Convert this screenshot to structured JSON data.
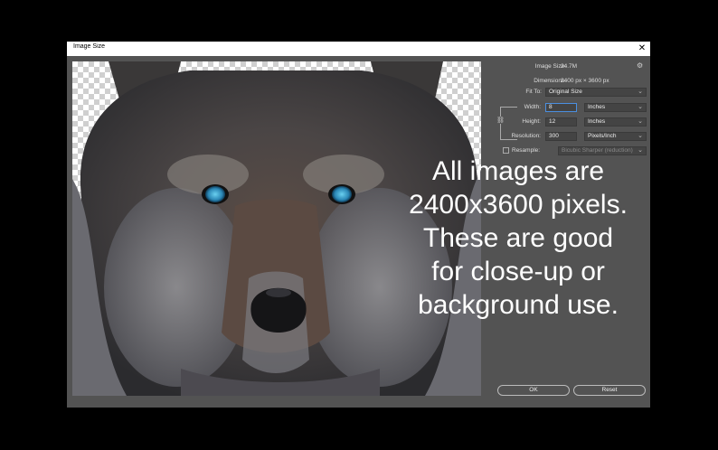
{
  "dialog": {
    "title": "Image Size",
    "close": "✕"
  },
  "overlay_text": "All images are\n2400x3600 pixels.\nThese are good\nfor close-up or\nbackground use.",
  "panel": {
    "image_size_label": "Image Size:",
    "image_size_value": "24.7M",
    "dimensions_label": "Dimensions:",
    "dimensions_value": "2400 px  ×  3600 px",
    "fit_to_label": "Fit To:",
    "fit_to_value": "Original Size",
    "width_label": "Width:",
    "width_value": "8",
    "width_unit": "Inches",
    "height_label": "Height:",
    "height_value": "12",
    "height_unit": "Inches",
    "resolution_label": "Resolution:",
    "resolution_value": "300",
    "resolution_unit": "Pixels/Inch",
    "resample_label": "Resample:",
    "resample_value": "Bicubic Sharper (reduction)"
  },
  "buttons": {
    "ok": "OK",
    "reset": "Reset"
  },
  "icons": {
    "gear": "gear-icon",
    "chevron": "chevron-down-icon",
    "link": "link-icon"
  },
  "colors": {
    "dialog_bg": "#535353",
    "focus": "#4a8fe0",
    "eye": "#2a86b5"
  }
}
